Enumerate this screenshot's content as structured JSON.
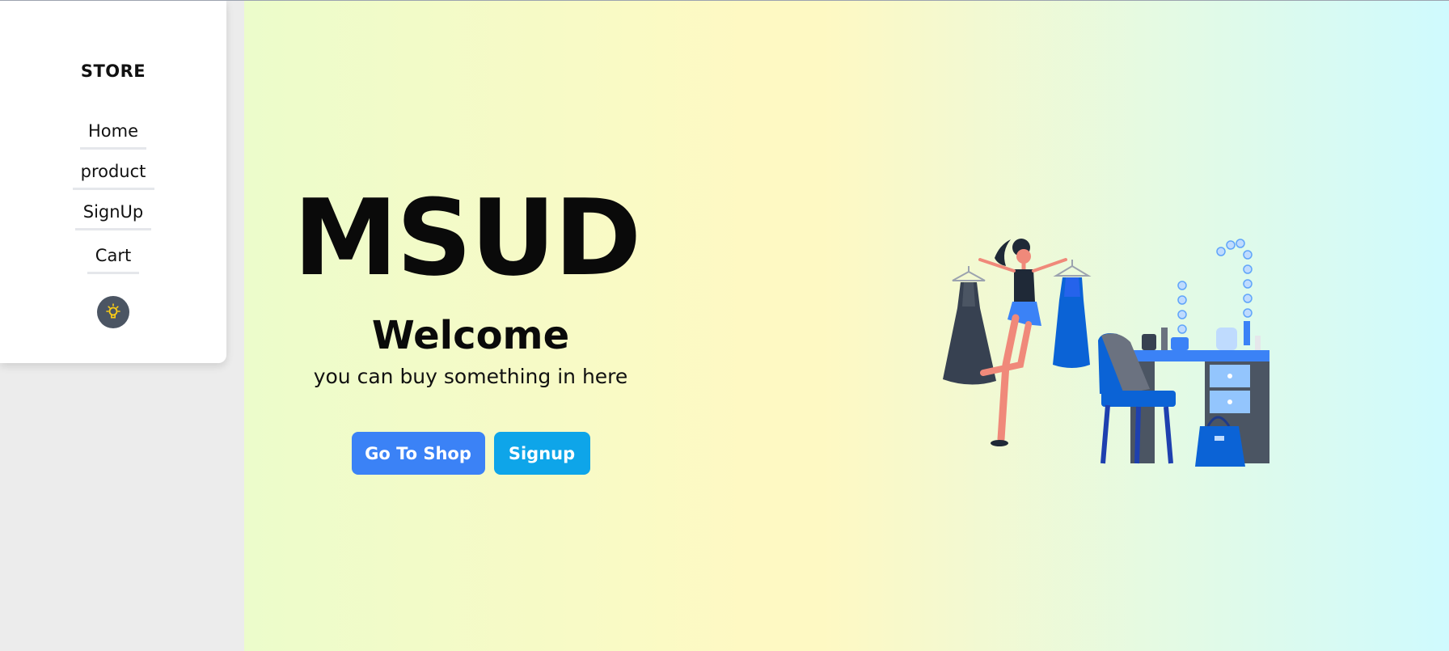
{
  "sidebar": {
    "brand": "STORE",
    "nav": [
      {
        "label": "Home"
      },
      {
        "label": "product"
      },
      {
        "label": "SignUp"
      },
      {
        "label": "Cart"
      }
    ],
    "theme_toggle_icon": "lightbulb-icon"
  },
  "hero": {
    "title": "MSUD",
    "welcome": "Welcome",
    "subtitle": "you can buy something in here",
    "buttons": {
      "shop": "Go To Shop",
      "signup": "Signup"
    },
    "illustration_icon": "shopping-woman-illustration"
  },
  "colors": {
    "primary": "#3b82f6",
    "secondary": "#0ea5e9",
    "toggle": "#4b5563",
    "gradient_left": "#ecfccb",
    "gradient_mid": "#fef9c3",
    "gradient_right": "#cffafe"
  }
}
